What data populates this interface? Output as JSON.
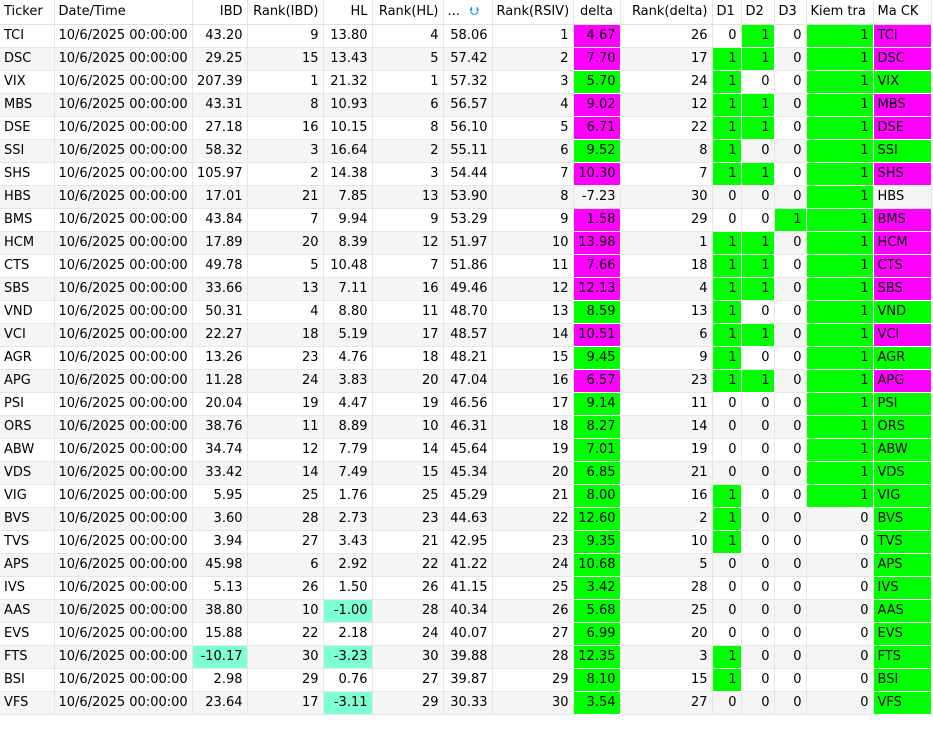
{
  "colors": {
    "green": "#00ff00",
    "magenta": "#ff00ff",
    "teal": "#7fffd4"
  },
  "headers": [
    "Ticker",
    "Date/Time",
    "IBD",
    "Rank(IBD)",
    "HL",
    "Rank(HL)",
    "...",
    "Rank(RSIV)",
    "delta",
    "Rank(delta)",
    "D1",
    "D2",
    "D3",
    "Kiem tra",
    "Ma CK"
  ],
  "sort_icon": "sort-arrow-icon",
  "rows": [
    [
      "TCI",
      "10/6/2025 00:00:00",
      "43.20",
      "9",
      "13.80",
      "4",
      "58.06",
      "1",
      "4.67",
      "26",
      "0",
      "1",
      "0",
      "1",
      "TCI",
      "magenta"
    ],
    [
      "DSC",
      "10/6/2025 00:00:00",
      "29.25",
      "15",
      "13.43",
      "5",
      "57.42",
      "2",
      "7.70",
      "17",
      "1",
      "1",
      "0",
      "1",
      "DSC",
      "magenta"
    ],
    [
      "VIX",
      "10/6/2025 00:00:00",
      "207.39",
      "1",
      "21.32",
      "1",
      "57.32",
      "3",
      "5.70",
      "24",
      "1",
      "0",
      "0",
      "1",
      "VIX",
      "green"
    ],
    [
      "MBS",
      "10/6/2025 00:00:00",
      "43.31",
      "8",
      "10.93",
      "6",
      "56.57",
      "4",
      "9.02",
      "12",
      "1",
      "1",
      "0",
      "1",
      "MBS",
      "magenta"
    ],
    [
      "DSE",
      "10/6/2025 00:00:00",
      "27.18",
      "16",
      "10.15",
      "8",
      "56.10",
      "5",
      "6.71",
      "22",
      "1",
      "1",
      "0",
      "1",
      "DSE",
      "magenta"
    ],
    [
      "SSI",
      "10/6/2025 00:00:00",
      "58.32",
      "3",
      "16.64",
      "2",
      "55.11",
      "6",
      "9.52",
      "8",
      "1",
      "0",
      "0",
      "1",
      "SSI",
      "green"
    ],
    [
      "SHS",
      "10/6/2025 00:00:00",
      "105.97",
      "2",
      "14.38",
      "3",
      "54.44",
      "7",
      "10.30",
      "7",
      "1",
      "1",
      "0",
      "1",
      "SHS",
      "magenta"
    ],
    [
      "HBS",
      "10/6/2025 00:00:00",
      "17.01",
      "21",
      "7.85",
      "13",
      "53.90",
      "8",
      "-7.23",
      "30",
      "0",
      "0",
      "0",
      "1",
      "HBS",
      "none"
    ],
    [
      "BMS",
      "10/6/2025 00:00:00",
      "43.84",
      "7",
      "9.94",
      "9",
      "53.29",
      "9",
      "1.58",
      "29",
      "0",
      "0",
      "1",
      "1",
      "BMS",
      "magenta"
    ],
    [
      "HCM",
      "10/6/2025 00:00:00",
      "17.89",
      "20",
      "8.39",
      "12",
      "51.97",
      "10",
      "13.98",
      "1",
      "1",
      "1",
      "0",
      "1",
      "HCM",
      "magenta"
    ],
    [
      "CTS",
      "10/6/2025 00:00:00",
      "49.78",
      "5",
      "10.48",
      "7",
      "51.86",
      "11",
      "7.66",
      "18",
      "1",
      "1",
      "0",
      "1",
      "CTS",
      "magenta"
    ],
    [
      "SBS",
      "10/6/2025 00:00:00",
      "33.66",
      "13",
      "7.11",
      "16",
      "49.46",
      "12",
      "12.13",
      "4",
      "1",
      "1",
      "0",
      "1",
      "SBS",
      "magenta"
    ],
    [
      "VND",
      "10/6/2025 00:00:00",
      "50.31",
      "4",
      "8.80",
      "11",
      "48.70",
      "13",
      "8.59",
      "13",
      "1",
      "0",
      "0",
      "1",
      "VND",
      "green"
    ],
    [
      "VCI",
      "10/6/2025 00:00:00",
      "22.27",
      "18",
      "5.19",
      "17",
      "48.57",
      "14",
      "10.51",
      "6",
      "1",
      "1",
      "0",
      "1",
      "VCI",
      "magenta"
    ],
    [
      "AGR",
      "10/6/2025 00:00:00",
      "13.26",
      "23",
      "4.76",
      "18",
      "48.21",
      "15",
      "9.45",
      "9",
      "1",
      "0",
      "0",
      "1",
      "AGR",
      "green"
    ],
    [
      "APG",
      "10/6/2025 00:00:00",
      "11.28",
      "24",
      "3.83",
      "20",
      "47.04",
      "16",
      "6.57",
      "23",
      "1",
      "1",
      "0",
      "1",
      "APG",
      "magenta"
    ],
    [
      "PSI",
      "10/6/2025 00:00:00",
      "20.04",
      "19",
      "4.47",
      "19",
      "46.56",
      "17",
      "9.14",
      "11",
      "0",
      "0",
      "0",
      "1",
      "PSI",
      "green"
    ],
    [
      "ORS",
      "10/6/2025 00:00:00",
      "38.76",
      "11",
      "8.89",
      "10",
      "46.31",
      "18",
      "8.27",
      "14",
      "0",
      "0",
      "0",
      "1",
      "ORS",
      "green"
    ],
    [
      "ABW",
      "10/6/2025 00:00:00",
      "34.74",
      "12",
      "7.79",
      "14",
      "45.64",
      "19",
      "7.01",
      "19",
      "0",
      "0",
      "0",
      "1",
      "ABW",
      "green"
    ],
    [
      "VDS",
      "10/6/2025 00:00:00",
      "33.42",
      "14",
      "7.49",
      "15",
      "45.34",
      "20",
      "6.85",
      "21",
      "0",
      "0",
      "0",
      "1",
      "VDS",
      "green"
    ],
    [
      "VIG",
      "10/6/2025 00:00:00",
      "5.95",
      "25",
      "1.76",
      "25",
      "45.29",
      "21",
      "8.00",
      "16",
      "1",
      "0",
      "0",
      "1",
      "VIG",
      "green"
    ],
    [
      "BVS",
      "10/6/2025 00:00:00",
      "3.60",
      "28",
      "2.73",
      "23",
      "44.63",
      "22",
      "12.60",
      "2",
      "1",
      "0",
      "0",
      "0",
      "BVS",
      "green"
    ],
    [
      "TVS",
      "10/6/2025 00:00:00",
      "3.94",
      "27",
      "3.43",
      "21",
      "42.95",
      "23",
      "9.35",
      "10",
      "1",
      "0",
      "0",
      "0",
      "TVS",
      "green"
    ],
    [
      "APS",
      "10/6/2025 00:00:00",
      "45.98",
      "6",
      "2.92",
      "22",
      "41.22",
      "24",
      "10.68",
      "5",
      "0",
      "0",
      "0",
      "0",
      "APS",
      "green"
    ],
    [
      "IVS",
      "10/6/2025 00:00:00",
      "5.13",
      "26",
      "1.50",
      "26",
      "41.15",
      "25",
      "3.42",
      "28",
      "0",
      "0",
      "0",
      "0",
      "IVS",
      "green"
    ],
    [
      "AAS",
      "10/6/2025 00:00:00",
      "38.80",
      "10",
      "-1.00",
      "28",
      "40.34",
      "26",
      "5.68",
      "25",
      "0",
      "0",
      "0",
      "0",
      "AAS",
      "green"
    ],
    [
      "EVS",
      "10/6/2025 00:00:00",
      "15.88",
      "22",
      "2.18",
      "24",
      "40.07",
      "27",
      "6.99",
      "20",
      "0",
      "0",
      "0",
      "0",
      "EVS",
      "green"
    ],
    [
      "FTS",
      "10/6/2025 00:00:00",
      "-10.17",
      "30",
      "-3.23",
      "30",
      "39.88",
      "28",
      "12.35",
      "3",
      "1",
      "0",
      "0",
      "0",
      "FTS",
      "green"
    ],
    [
      "BSI",
      "10/6/2025 00:00:00",
      "2.98",
      "29",
      "0.76",
      "27",
      "39.87",
      "29",
      "8.10",
      "15",
      "1",
      "0",
      "0",
      "0",
      "BSI",
      "green"
    ],
    [
      "VFS",
      "10/6/2025 00:00:00",
      "23.64",
      "17",
      "-3.11",
      "29",
      "30.33",
      "30",
      "3.54",
      "27",
      "0",
      "0",
      "0",
      "0",
      "VFS",
      "green"
    ]
  ]
}
